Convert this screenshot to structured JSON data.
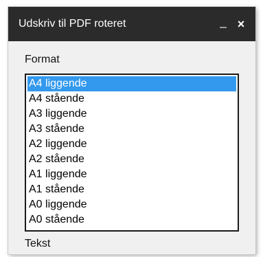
{
  "dialog": {
    "title": "Udskriv til PDF roteret",
    "minimize_symbol": "_",
    "close_symbol": "×"
  },
  "format": {
    "label": "Format",
    "options": [
      "A4 liggende",
      "A4 stående",
      "A3 liggende",
      "A3 stående",
      "A2 liggende",
      "A2 stående",
      "A1 liggende",
      "A1 stående",
      "A0 liggende",
      "A0 stående"
    ],
    "selected_value": "A4 liggende",
    "selected_color": "#3399ee"
  },
  "tekst": {
    "label": "Tekst"
  }
}
